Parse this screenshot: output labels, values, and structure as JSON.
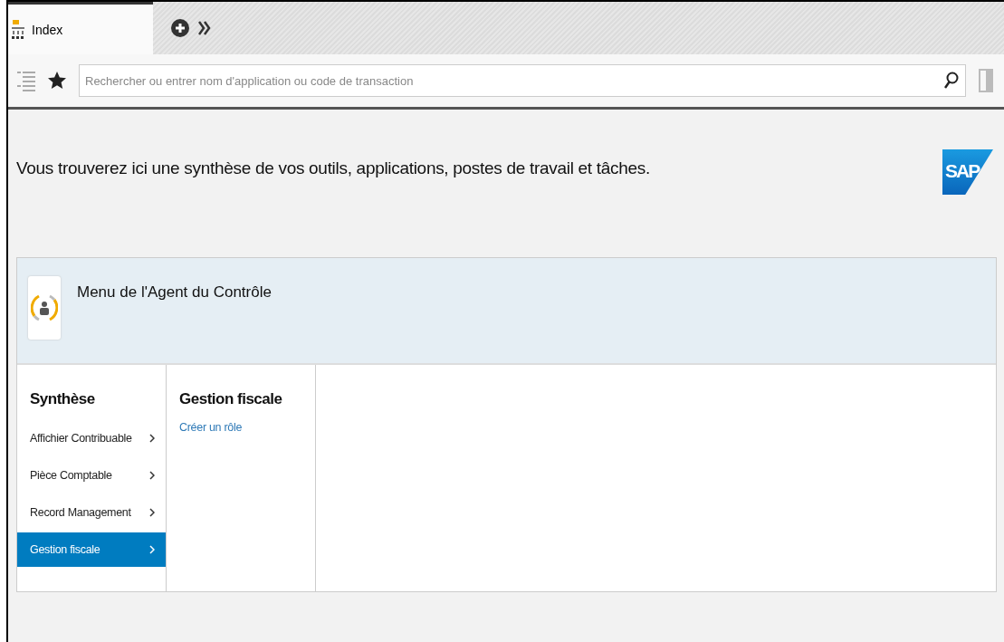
{
  "tabs": [
    {
      "label": "Index",
      "selected": true
    }
  ],
  "search": {
    "placeholder": "Rechercher ou entrer nom d'application ou code de transaction"
  },
  "intro": "Vous trouverez ici une synthèse de vos outils, applications, postes de travail et tâches.",
  "logo_text": "SAP",
  "role": {
    "title": "Menu de l'Agent du Contrôle"
  },
  "navigation": {
    "title": "Synthèse",
    "items": [
      {
        "label": "Affichier Contribuable",
        "selected": false
      },
      {
        "label": "Pièce Comptable",
        "selected": false
      },
      {
        "label": "Record Management",
        "selected": false
      },
      {
        "label": "Gestion fiscale",
        "selected": true
      }
    ]
  },
  "detail": {
    "title": "Gestion fiscale",
    "links": [
      "Créer un rôle"
    ]
  }
}
